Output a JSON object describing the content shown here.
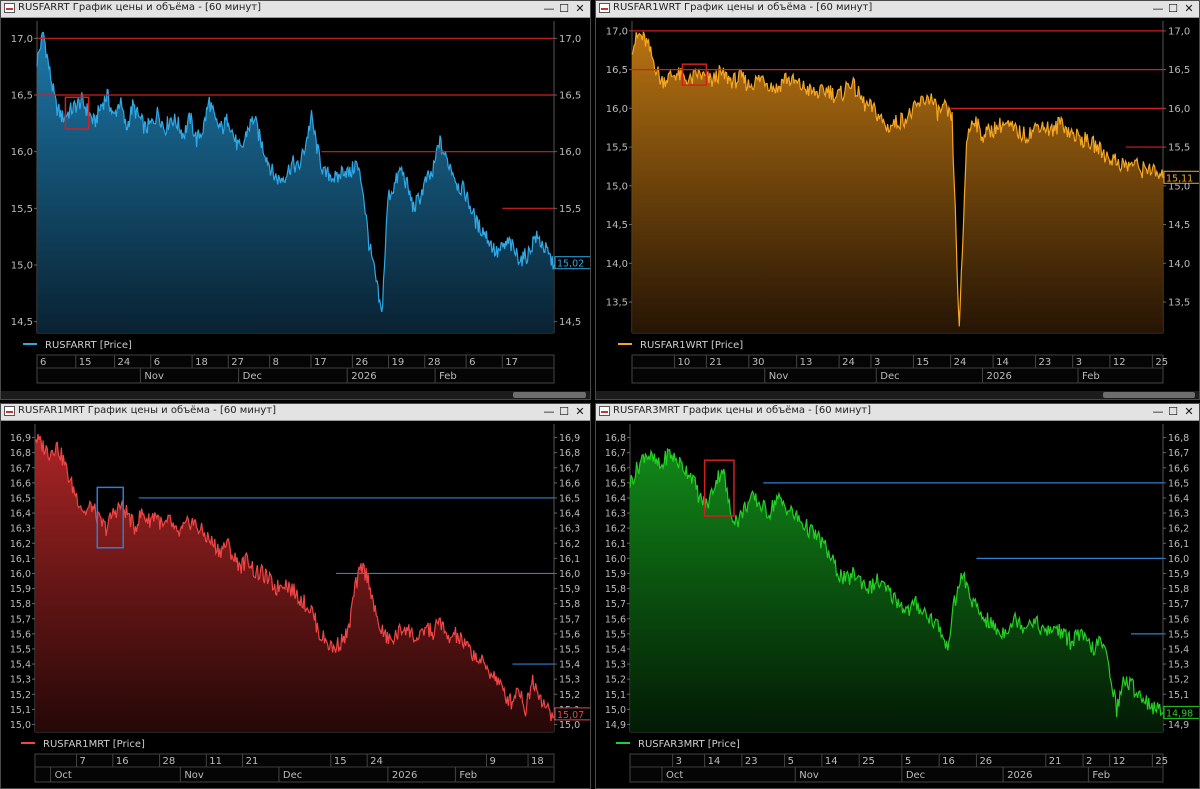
{
  "windows": [
    {
      "id": "w1",
      "title": "RUSFARRT График цены и объёма - [60 минут]",
      "color": "#2fa8e6",
      "gradTop": "#1e7fb3",
      "gradBottom": "#0a2638",
      "legend": "RUSFARRT [Price]",
      "lastPrice": "15,02",
      "lastY": 15.02,
      "yMin": 14.4,
      "yMax": 17.1,
      "yTicks": [
        "14,5",
        "15,0",
        "15,5",
        "16,0",
        "16,5",
        "17,0"
      ],
      "levels": [
        {
          "y": 17.0,
          "from": 0.0,
          "color": "#d02020"
        },
        {
          "y": 16.5,
          "from": 0.0,
          "color": "#d02020"
        },
        {
          "y": 16.0,
          "from": 0.55,
          "color": "#d02020"
        },
        {
          "y": 15.5,
          "from": 0.9,
          "color": "#d02020"
        }
      ],
      "box": {
        "x1": 0.055,
        "x2": 0.1,
        "y1": 16.2,
        "y2": 16.48,
        "color": "#d02020"
      },
      "series": [
        16.8,
        17.05,
        16.7,
        16.4,
        16.3,
        16.35,
        16.4,
        16.45,
        16.35,
        16.25,
        16.4,
        16.5,
        16.3,
        16.45,
        16.2,
        16.4,
        16.3,
        16.2,
        16.25,
        16.35,
        16.2,
        16.3,
        16.25,
        16.15,
        16.3,
        16.1,
        16.2,
        16.45,
        16.25,
        16.2,
        16.3,
        16.1,
        16.0,
        16.2,
        16.3,
        16.1,
        15.95,
        15.8,
        15.75,
        15.8,
        15.9,
        15.85,
        16.05,
        16.3,
        16.0,
        15.8,
        15.8,
        15.75,
        15.85,
        15.8,
        15.9,
        15.7,
        15.2,
        14.9,
        14.55,
        15.6,
        15.7,
        15.85,
        15.7,
        15.5,
        15.6,
        15.75,
        15.8,
        16.1,
        15.95,
        15.85,
        15.7,
        15.65,
        15.5,
        15.35,
        15.3,
        15.2,
        15.1,
        15.15,
        15.2,
        15.1,
        15.05,
        15.1,
        15.25,
        15.2,
        15.1,
        15.0
      ],
      "xTicks": [
        "6",
        "15",
        "24",
        "6",
        "18",
        "27",
        "8",
        "17",
        "26",
        "19",
        "28",
        "6",
        "17"
      ],
      "xTickPos": [
        0.0,
        0.075,
        0.15,
        0.22,
        0.3,
        0.37,
        0.45,
        0.53,
        0.61,
        0.68,
        0.75,
        0.83,
        0.9
      ],
      "months": [
        {
          "label": "Nov",
          "pos": 0.2
        },
        {
          "label": "Dec",
          "pos": 0.39
        },
        {
          "label": "2026",
          "pos": 0.6
        },
        {
          "label": "Feb",
          "pos": 0.77
        }
      ],
      "scrollbar": true,
      "thumbLeft": 0.87,
      "thumbWidth": 0.13
    },
    {
      "id": "w2",
      "title": "RUSFAR1WRT График цены и объёма - [60 минут]",
      "color": "#f5a623",
      "gradTop": "#c37a12",
      "gradBottom": "#2a1705",
      "legend": "RUSFAR1WRT [Price]",
      "lastPrice": "15,11",
      "lastY": 15.11,
      "yMin": 13.1,
      "yMax": 17.05,
      "yTicks": [
        "13,5",
        "14,0",
        "14,5",
        "15,0",
        "15,5",
        "16,0",
        "16,5",
        "17,0"
      ],
      "levels": [
        {
          "y": 17.0,
          "from": 0.0,
          "color": "#d02020"
        },
        {
          "y": 16.5,
          "from": 0.0,
          "color": "#d02020"
        },
        {
          "y": 16.0,
          "from": 0.6,
          "color": "#d02020"
        },
        {
          "y": 15.5,
          "from": 0.93,
          "color": "#d02020"
        }
      ],
      "box": {
        "x1": 0.095,
        "x2": 0.14,
        "y1": 16.3,
        "y2": 16.57,
        "color": "#d02020"
      },
      "series": [
        16.8,
        16.95,
        16.85,
        16.6,
        16.35,
        16.4,
        16.45,
        16.4,
        16.35,
        16.45,
        16.4,
        16.35,
        16.45,
        16.4,
        16.35,
        16.4,
        16.3,
        16.35,
        16.4,
        16.3,
        16.25,
        16.4,
        16.35,
        16.3,
        16.25,
        16.2,
        16.2,
        16.25,
        16.15,
        16.2,
        16.35,
        16.2,
        16.05,
        16.0,
        15.9,
        15.75,
        15.8,
        15.85,
        15.9,
        16.0,
        16.1,
        16.15,
        15.95,
        16.0,
        15.85,
        13.1,
        15.6,
        15.9,
        15.65,
        15.7,
        15.75,
        15.8,
        15.75,
        15.7,
        15.65,
        15.7,
        15.8,
        15.75,
        15.7,
        15.85,
        15.7,
        15.65,
        15.6,
        15.55,
        15.5,
        15.4,
        15.35,
        15.3,
        15.25,
        15.3,
        15.2,
        15.25,
        15.15,
        15.1
      ],
      "xTicks": [
        "10",
        "21",
        "30",
        "13",
        "24",
        "3",
        "15",
        "24",
        "14",
        "23",
        "3",
        "12",
        "25"
      ],
      "xTickPos": [
        0.08,
        0.14,
        0.22,
        0.31,
        0.39,
        0.45,
        0.53,
        0.6,
        0.68,
        0.76,
        0.83,
        0.9,
        0.98
      ],
      "months": [
        {
          "label": "Nov",
          "pos": 0.25
        },
        {
          "label": "Dec",
          "pos": 0.46
        },
        {
          "label": "2026",
          "pos": 0.66
        },
        {
          "label": "Feb",
          "pos": 0.84
        }
      ],
      "scrollbar": true,
      "thumbLeft": 0.84,
      "thumbWidth": 0.16
    },
    {
      "id": "w3",
      "title": "RUSFAR1MRT График цены и объёма - [60 минут]",
      "color": "#f04545",
      "gradTop": "#b52727",
      "gradBottom": "#2a0808",
      "legend": "RUSFAR1MRT [Price]",
      "lastPrice": "15,07",
      "lastY": 15.07,
      "yMin": 14.95,
      "yMax": 16.95,
      "yTicks": [
        "15,0",
        "15,1",
        "15,2",
        "15,3",
        "15,4",
        "15,5",
        "15,6",
        "15,7",
        "15,8",
        "15,9",
        "16,0",
        "16,1",
        "16,2",
        "16,3",
        "16,4",
        "16,5",
        "16,6",
        "16,7",
        "16,8",
        "16,9"
      ],
      "levels": [
        {
          "y": 16.5,
          "from": 0.2,
          "color": "#2d7fd0"
        },
        {
          "y": 16.0,
          "from": 0.58,
          "color": "#2d7fd0"
        },
        {
          "y": 15.4,
          "from": 0.92,
          "color": "#2d7fd0"
        }
      ],
      "box": {
        "x1": 0.12,
        "x2": 0.17,
        "y1": 16.17,
        "y2": 16.57,
        "color": "#2d7fd0"
      },
      "series": [
        16.9,
        16.85,
        16.8,
        16.85,
        16.75,
        16.6,
        16.5,
        16.4,
        16.45,
        16.35,
        16.3,
        16.4,
        16.45,
        16.4,
        16.3,
        16.4,
        16.35,
        16.4,
        16.3,
        16.35,
        16.25,
        16.3,
        16.35,
        16.3,
        16.25,
        16.2,
        16.15,
        16.2,
        16.1,
        16.05,
        16.1,
        16.0,
        16.0,
        15.95,
        15.9,
        15.95,
        15.9,
        15.85,
        15.8,
        15.75,
        15.6,
        15.55,
        15.5,
        15.55,
        15.6,
        15.9,
        16.05,
        15.95,
        15.7,
        15.6,
        15.55,
        15.6,
        15.65,
        15.6,
        15.55,
        15.65,
        15.6,
        15.7,
        15.55,
        15.6,
        15.55,
        15.5,
        15.45,
        15.4,
        15.35,
        15.3,
        15.2,
        15.15,
        15.25,
        15.1,
        15.3,
        15.2,
        15.1,
        15.05
      ],
      "xTicks": [
        "7",
        "16",
        "28",
        "11",
        "21",
        "15",
        "24",
        "9",
        "18"
      ],
      "xTickPos": [
        0.08,
        0.15,
        0.24,
        0.33,
        0.4,
        0.57,
        0.64,
        0.87,
        0.95
      ],
      "months": [
        {
          "label": "Oct",
          "pos": 0.03
        },
        {
          "label": "Nov",
          "pos": 0.28
        },
        {
          "label": "Dec",
          "pos": 0.47
        },
        {
          "label": "2026",
          "pos": 0.68
        },
        {
          "label": "Feb",
          "pos": 0.81
        }
      ],
      "scrollbar": false,
      "thumbLeft": 0,
      "thumbWidth": 0
    },
    {
      "id": "w4",
      "title": "RUSFAR3MRT График цены и объёма - [60 минут]",
      "color": "#24d024",
      "gradTop": "#13901a",
      "gradBottom": "#031d05",
      "legend": "RUSFAR3MRT [Price]",
      "lastPrice": "14,98",
      "lastY": 14.98,
      "yMin": 14.85,
      "yMax": 16.85,
      "yTicks": [
        "14,9",
        "15,0",
        "15,1",
        "15,2",
        "15,3",
        "15,4",
        "15,5",
        "15,6",
        "15,7",
        "15,8",
        "15,9",
        "16,0",
        "16,1",
        "16,2",
        "16,3",
        "16,4",
        "16,5",
        "16,6",
        "16,7",
        "16,8"
      ],
      "levels": [
        {
          "y": 16.5,
          "from": 0.25,
          "color": "#2d7fd0"
        },
        {
          "y": 16.0,
          "from": 0.65,
          "color": "#2d7fd0"
        },
        {
          "y": 15.5,
          "from": 0.94,
          "color": "#2d7fd0"
        }
      ],
      "box": {
        "x1": 0.14,
        "x2": 0.195,
        "y1": 16.28,
        "y2": 16.65,
        "color": "#d02020"
      },
      "series": [
        16.5,
        16.6,
        16.7,
        16.65,
        16.6,
        16.7,
        16.65,
        16.6,
        16.55,
        16.4,
        16.35,
        16.5,
        16.6,
        16.3,
        16.25,
        16.35,
        16.4,
        16.35,
        16.3,
        16.4,
        16.35,
        16.3,
        16.25,
        16.2,
        16.15,
        16.1,
        16.0,
        15.9,
        15.85,
        15.9,
        15.85,
        15.8,
        15.85,
        15.8,
        15.75,
        15.7,
        15.65,
        15.7,
        15.65,
        15.6,
        15.55,
        15.4,
        15.7,
        15.9,
        15.75,
        15.65,
        15.6,
        15.55,
        15.5,
        15.55,
        15.6,
        15.55,
        15.6,
        15.55,
        15.5,
        15.55,
        15.5,
        15.45,
        15.5,
        15.45,
        15.4,
        15.45,
        15.3,
        15.0,
        15.2,
        15.15,
        15.1,
        15.05,
        15.0,
        14.98
      ],
      "xTicks": [
        "3",
        "14",
        "23",
        "5",
        "14",
        "25",
        "5",
        "16",
        "26",
        "21",
        "2",
        "12",
        "25"
      ],
      "xTickPos": [
        0.08,
        0.14,
        0.21,
        0.29,
        0.36,
        0.43,
        0.51,
        0.58,
        0.65,
        0.78,
        0.85,
        0.9,
        0.98
      ],
      "months": [
        {
          "label": "Oct",
          "pos": 0.06
        },
        {
          "label": "Nov",
          "pos": 0.31
        },
        {
          "label": "Dec",
          "pos": 0.51
        },
        {
          "label": "2026",
          "pos": 0.7
        },
        {
          "label": "Feb",
          "pos": 0.86
        }
      ],
      "scrollbar": false,
      "thumbLeft": 0,
      "thumbWidth": 0
    }
  ],
  "icons": {
    "minimize": "minimize-icon",
    "maximize": "maximize-icon",
    "close": "close-icon"
  },
  "buttons": {
    "minimize": "—",
    "maximize": "☐",
    "close": "✕"
  }
}
